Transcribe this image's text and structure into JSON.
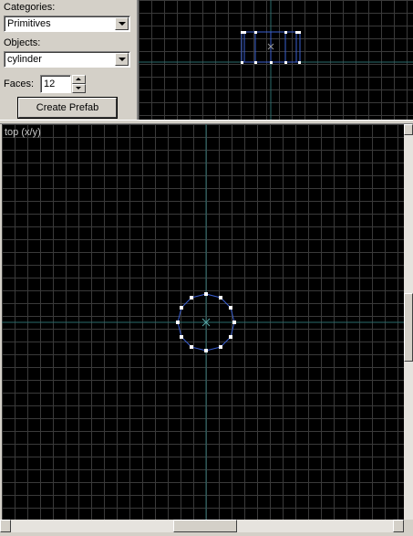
{
  "panel": {
    "categories_label": "Categories:",
    "categories_value": "Primitives",
    "objects_label": "Objects:",
    "objects_value": "cylinder",
    "faces_label": "Faces:",
    "faces_value": "12",
    "create_prefab_label": "Create Prefab"
  },
  "main_view": {
    "label": "top (x/y)"
  },
  "icons": {
    "dropdown": "chevron-down-icon",
    "spin_up": "arrow-up-icon",
    "spin_down": "arrow-down-icon",
    "origin": "x-mark-icon"
  },
  "colors": {
    "background": "#000000",
    "grid": "#3a3a3a",
    "axis": "#2a6b6b",
    "shape_outline": "#3a5fd0",
    "vertex": "#ffffff",
    "panel": "#d4d0c8"
  }
}
